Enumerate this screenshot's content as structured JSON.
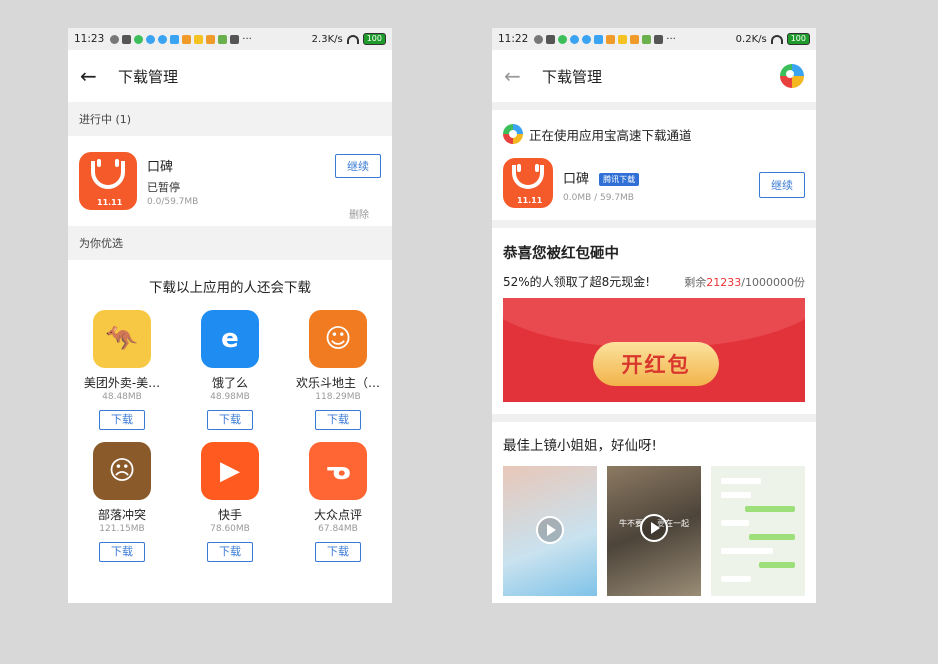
{
  "left_screen": {
    "status": {
      "time": "11:23",
      "speed": "2.3K/s",
      "battery": "100"
    },
    "title": "下载管理",
    "in_progress_label": "进行中 (1)",
    "download": {
      "name": "口碑",
      "status": "已暂停",
      "size": "0.0/59.7MB",
      "continue_label": "继续",
      "delete_label": "删除",
      "icon_tag": "11.11"
    },
    "for_you_label": "为你优选",
    "recommend_title": "下载以上应用的人还会下载",
    "apps": [
      {
        "name": "美团外卖-美…",
        "size": "48.48MB",
        "button": "下载",
        "icon": "meituan-waimai-icon",
        "color": "#f7c843"
      },
      {
        "name": "饿了么",
        "size": "48.98MB",
        "button": "下载",
        "icon": "eleme-icon",
        "color": "#1e8cf0"
      },
      {
        "name": "欢乐斗地主（…",
        "size": "118.29MB",
        "button": "下载",
        "icon": "doudizhu-icon",
        "color": "#f07b20"
      },
      {
        "name": "部落冲突",
        "size": "121.15MB",
        "button": "下载",
        "icon": "clash-of-clans-icon",
        "color": "#8a5a2b"
      },
      {
        "name": "快手",
        "size": "78.60MB",
        "button": "下载",
        "icon": "kuaishou-icon",
        "color": "#ff5a1f"
      },
      {
        "name": "大众点评",
        "size": "67.84MB",
        "button": "下载",
        "icon": "dianping-icon",
        "color": "#ff6633"
      }
    ]
  },
  "right_screen": {
    "status": {
      "time": "11:22",
      "speed": "0.2K/s",
      "battery": "100"
    },
    "title": "下载管理",
    "channel_text": "正在使用应用宝高速下载通道",
    "download": {
      "name": "口碑",
      "badge": "腾讯下载",
      "size": "0.0MB / 59.7MB",
      "continue_label": "继续",
      "icon_tag": "11.11"
    },
    "hongbao": {
      "title": "恭喜您被红包砸中",
      "subtitle": "52%的人领取了超8元现金!",
      "remain_prefix": "剩余",
      "remain_count": "21233",
      "remain_suffix": "/1000000份",
      "open_label": "开红包"
    },
    "video_title": "最佳上镜小姐姐，好仙呀!",
    "thumb_texts": [
      "牛不要",
      "要在一起"
    ]
  }
}
